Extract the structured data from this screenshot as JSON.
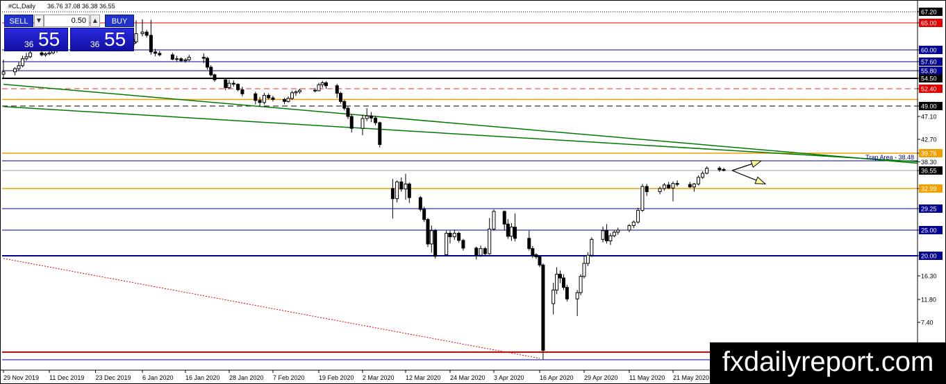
{
  "header": {
    "symbol": "#CL,Daily",
    "ohlc": "36.76 37.08 36.38 36.55"
  },
  "trade_panel": {
    "sell_label": "SELL",
    "buy_label": "BUY",
    "lot_value": "0.50",
    "sell_price_small": "36",
    "sell_price_big": "55",
    "buy_price_small": "36",
    "buy_price_big": "55"
  },
  "watermark": "fxdailyreport.com",
  "colors": {
    "red": "#e00000",
    "orange": "#f0a000",
    "navy": "#000090",
    "green": "#007a00",
    "black": "#000000",
    "gray": "#a0a0a0",
    "dashred": "#e03030",
    "hollow_up": "#ffffff",
    "panel_blue": "#2233cc",
    "tag_bg": "#000000",
    "arrow_yellow": "#ffff99"
  },
  "price_axis": [
    {
      "label": "67.20",
      "price": 67.2,
      "style": "black"
    },
    {
      "label": "65.00",
      "price": 65.0,
      "style": "red"
    },
    {
      "label": "60.00",
      "price": 60.0,
      "style": "navy"
    },
    {
      "label": "57.60",
      "price": 57.6,
      "style": "navy"
    },
    {
      "label": "55.80",
      "price": 55.8,
      "style": "navy"
    },
    {
      "label": "54.50",
      "price": 54.5,
      "style": "black"
    },
    {
      "label": "52.40",
      "price": 52.4,
      "style": "red"
    },
    {
      "label": "49.00",
      "price": 49.0,
      "style": "black"
    },
    {
      "label": "47.10",
      "price": 47.1,
      "style": "plain"
    },
    {
      "label": "42.70",
      "price": 42.7,
      "style": "plain"
    },
    {
      "label": "39.76",
      "price": 39.76,
      "style": "orange"
    },
    {
      "label": "38.30",
      "price": 38.3,
      "style": "plain"
    },
    {
      "label": "36.55",
      "price": 36.55,
      "style": "black"
    },
    {
      "label": "32.99",
      "price": 32.99,
      "style": "orange"
    },
    {
      "label": "29.25",
      "price": 29.25,
      "style": "navy"
    },
    {
      "label": "25.00",
      "price": 25.0,
      "style": "navy"
    },
    {
      "label": "20.00",
      "price": 20.0,
      "style": "navy"
    },
    {
      "label": "16.30",
      "price": 16.3,
      "style": "plain"
    },
    {
      "label": "11.80",
      "price": 11.8,
      "style": "plain"
    },
    {
      "label": "7.40",
      "price": 7.4,
      "style": "plain"
    }
  ],
  "trap_label": "Trap Area - 38.48",
  "levels": [
    {
      "price": 67.2,
      "style": "black-dotted"
    },
    {
      "price": 65.0,
      "style": "red"
    },
    {
      "price": 60.0,
      "style": "navy"
    },
    {
      "price": 57.6,
      "style": "navy"
    },
    {
      "price": 55.8,
      "style": "navy"
    },
    {
      "price": 54.5,
      "style": "black-thick"
    },
    {
      "price": 52.4,
      "style": "red-dashed"
    },
    {
      "price": 50.3,
      "style": "orange"
    },
    {
      "price": 49.0,
      "style": "black-dashed"
    },
    {
      "price": 39.76,
      "style": "orange"
    },
    {
      "price": 38.48,
      "style": "navy"
    },
    {
      "price": 36.55,
      "style": "gray"
    },
    {
      "price": 32.99,
      "style": "orange"
    },
    {
      "price": 29.25,
      "style": "navy"
    },
    {
      "price": 25.0,
      "style": "navy"
    },
    {
      "price": 20.0,
      "style": "navy-thick"
    },
    {
      "price": 0.6,
      "style": "red-thick"
    },
    {
      "price": -0.5,
      "style": "navy"
    }
  ],
  "trendlines": [
    {
      "from": {
        "day": "2019-11-29",
        "price": 53.3
      },
      "to": {
        "day": "2020-06-05",
        "price": 38.0
      }
    },
    {
      "from": {
        "day": "2019-11-29",
        "price": 48.9
      },
      "to": {
        "day": "2020-06-05",
        "price": 38.3
      }
    }
  ],
  "ma_line": {
    "from": {
      "day": "2019-11-29",
      "price": 19.5
    },
    "to": {
      "day": "2020-04-16",
      "price": -0.3
    }
  },
  "date_axis": [
    {
      "label": "29 Nov 2019",
      "day": "2019-11-29"
    },
    {
      "label": "11 Dec 2019",
      "day": "2019-12-11"
    },
    {
      "label": "23 Dec 2019",
      "day": "2019-12-23"
    },
    {
      "label": "6 Jan 2020",
      "day": "2020-01-06"
    },
    {
      "label": "16 Jan 2020",
      "day": "2020-01-16"
    },
    {
      "label": "28 Jan 2020",
      "day": "2020-01-28"
    },
    {
      "label": "7 Feb 2020",
      "day": "2020-02-07"
    },
    {
      "label": "19 Feb 2020",
      "day": "2020-02-19"
    },
    {
      "label": "2 Mar 2020",
      "day": "2020-03-02"
    },
    {
      "label": "12 Mar 2020",
      "day": "2020-03-12"
    },
    {
      "label": "24 Mar 2020",
      "day": "2020-03-24"
    },
    {
      "label": "3 Apr 2020",
      "day": "2020-04-03"
    },
    {
      "label": "16 Apr 2020",
      "day": "2020-04-16"
    },
    {
      "label": "29 Apr 2020",
      "day": "2020-04-29"
    },
    {
      "label": "11 May 2020",
      "day": "2020-05-11"
    },
    {
      "label": "21 May 2020",
      "day": "2020-05-21"
    }
  ],
  "chart_data": {
    "type": "candlestick",
    "candles": [
      {
        "day": "2019-11-29",
        "o": 55.2,
        "h": 58.0,
        "l": 54.5,
        "c": 55.6
      },
      {
        "day": "2019-12-02",
        "o": 55.6,
        "h": 56.5,
        "l": 55.0,
        "c": 56.2
      },
      {
        "day": "2019-12-03",
        "o": 56.2,
        "h": 57.5,
        "l": 55.8,
        "c": 56.8
      },
      {
        "day": "2019-12-04",
        "o": 56.8,
        "h": 58.8,
        "l": 56.5,
        "c": 58.2
      },
      {
        "day": "2019-12-05",
        "o": 58.2,
        "h": 59.4,
        "l": 57.8,
        "c": 58.6
      },
      {
        "day": "2019-12-06",
        "o": 58.6,
        "h": 60.0,
        "l": 58.3,
        "c": 59.4
      },
      {
        "day": "2019-12-09",
        "o": 59.4,
        "h": 59.7,
        "l": 58.7,
        "c": 59.0
      },
      {
        "day": "2019-12-10",
        "o": 59.0,
        "h": 59.5,
        "l": 58.6,
        "c": 59.2
      },
      {
        "day": "2019-12-11",
        "o": 59.2,
        "h": 59.8,
        "l": 58.9,
        "c": 59.4
      },
      {
        "day": "2019-12-12",
        "o": 59.4,
        "h": 60.4,
        "l": 59.1,
        "c": 59.8
      },
      {
        "day": "2019-12-13",
        "o": 59.8,
        "h": 60.3,
        "l": 59.4,
        "c": 60.0
      },
      {
        "day": "2020-01-02",
        "o": 61.2,
        "h": 62.0,
        "l": 60.8,
        "c": 61.5
      },
      {
        "day": "2020-01-03",
        "o": 61.5,
        "h": 65.5,
        "l": 61.2,
        "c": 63.0
      },
      {
        "day": "2020-01-06",
        "o": 63.0,
        "h": 65.7,
        "l": 62.5,
        "c": 63.3
      },
      {
        "day": "2020-01-07",
        "o": 63.3,
        "h": 63.7,
        "l": 62.3,
        "c": 62.7
      },
      {
        "day": "2020-01-08",
        "o": 62.7,
        "h": 65.6,
        "l": 59.0,
        "c": 59.6
      },
      {
        "day": "2020-01-09",
        "o": 59.6,
        "h": 60.2,
        "l": 58.7,
        "c": 59.3
      },
      {
        "day": "2020-01-10",
        "o": 59.3,
        "h": 59.8,
        "l": 58.7,
        "c": 59.0
      },
      {
        "day": "2020-01-13",
        "o": 59.0,
        "h": 59.4,
        "l": 57.9,
        "c": 58.1
      },
      {
        "day": "2020-01-14",
        "o": 58.1,
        "h": 58.8,
        "l": 57.6,
        "c": 58.2
      },
      {
        "day": "2020-01-15",
        "o": 58.2,
        "h": 58.5,
        "l": 57.6,
        "c": 57.8
      },
      {
        "day": "2020-01-16",
        "o": 57.8,
        "h": 58.3,
        "l": 57.4,
        "c": 58.0
      },
      {
        "day": "2020-01-17",
        "o": 58.0,
        "h": 59.0,
        "l": 57.7,
        "c": 58.5
      },
      {
        "day": "2020-01-21",
        "o": 58.5,
        "h": 59.3,
        "l": 57.3,
        "c": 58.3
      },
      {
        "day": "2020-01-22",
        "o": 58.3,
        "h": 58.6,
        "l": 56.0,
        "c": 56.5
      },
      {
        "day": "2020-01-23",
        "o": 56.5,
        "h": 56.9,
        "l": 54.8,
        "c": 55.1
      },
      {
        "day": "2020-01-24",
        "o": 55.1,
        "h": 55.3,
        "l": 53.8,
        "c": 54.2
      },
      {
        "day": "2020-01-27",
        "o": 54.2,
        "h": 54.5,
        "l": 52.1,
        "c": 52.6
      },
      {
        "day": "2020-01-28",
        "o": 52.6,
        "h": 54.2,
        "l": 52.3,
        "c": 53.5
      },
      {
        "day": "2020-01-29",
        "o": 53.5,
        "h": 54.1,
        "l": 52.8,
        "c": 53.3
      },
      {
        "day": "2020-01-30",
        "o": 53.3,
        "h": 53.5,
        "l": 51.9,
        "c": 52.2
      },
      {
        "day": "2020-01-31",
        "o": 52.2,
        "h": 52.8,
        "l": 50.9,
        "c": 51.4
      },
      {
        "day": "2020-02-03",
        "o": 51.4,
        "h": 51.8,
        "l": 49.3,
        "c": 50.1
      },
      {
        "day": "2020-02-04",
        "o": 50.1,
        "h": 50.8,
        "l": 49.0,
        "c": 49.7
      },
      {
        "day": "2020-02-05",
        "o": 49.7,
        "h": 51.6,
        "l": 49.3,
        "c": 51.1
      },
      {
        "day": "2020-02-06",
        "o": 51.1,
        "h": 51.5,
        "l": 50.3,
        "c": 50.6
      },
      {
        "day": "2020-02-07",
        "o": 50.6,
        "h": 51.0,
        "l": 49.9,
        "c": 50.3
      },
      {
        "day": "2020-02-10",
        "o": 50.3,
        "h": 50.6,
        "l": 49.4,
        "c": 49.9
      },
      {
        "day": "2020-02-11",
        "o": 49.9,
        "h": 50.9,
        "l": 49.7,
        "c": 50.5
      },
      {
        "day": "2020-02-12",
        "o": 50.5,
        "h": 52.0,
        "l": 50.2,
        "c": 51.6
      },
      {
        "day": "2020-02-13",
        "o": 51.6,
        "h": 52.1,
        "l": 51.0,
        "c": 51.8
      },
      {
        "day": "2020-02-14",
        "o": 51.8,
        "h": 52.4,
        "l": 51.4,
        "c": 52.1
      },
      {
        "day": "2020-02-18",
        "o": 52.1,
        "h": 52.5,
        "l": 51.7,
        "c": 52.0
      },
      {
        "day": "2020-02-19",
        "o": 52.0,
        "h": 53.6,
        "l": 51.9,
        "c": 53.2
      },
      {
        "day": "2020-02-20",
        "o": 53.2,
        "h": 54.0,
        "l": 52.6,
        "c": 53.6
      },
      {
        "day": "2020-02-21",
        "o": 53.6,
        "h": 53.9,
        "l": 52.4,
        "c": 53.0
      },
      {
        "day": "2020-02-24",
        "o": 53.0,
        "h": 53.4,
        "l": 50.6,
        "c": 51.5
      },
      {
        "day": "2020-02-25",
        "o": 51.5,
        "h": 51.8,
        "l": 49.5,
        "c": 49.9
      },
      {
        "day": "2020-02-26",
        "o": 49.9,
        "h": 50.2,
        "l": 48.2,
        "c": 48.6
      },
      {
        "day": "2020-02-27",
        "o": 48.6,
        "h": 48.9,
        "l": 46.6,
        "c": 47.1
      },
      {
        "day": "2020-02-28",
        "o": 47.1,
        "h": 47.5,
        "l": 44.0,
        "c": 44.8
      },
      {
        "day": "2020-03-02",
        "o": 44.8,
        "h": 47.4,
        "l": 43.5,
        "c": 46.7
      },
      {
        "day": "2020-03-03",
        "o": 46.7,
        "h": 48.6,
        "l": 46.2,
        "c": 47.2
      },
      {
        "day": "2020-03-04",
        "o": 47.2,
        "h": 47.9,
        "l": 46.0,
        "c": 46.8
      },
      {
        "day": "2020-03-05",
        "o": 46.8,
        "h": 47.2,
        "l": 45.4,
        "c": 45.9
      },
      {
        "day": "2020-03-06",
        "o": 45.9,
        "h": 46.1,
        "l": 41.0,
        "c": 41.6
      },
      {
        "day": "2020-03-09",
        "o": 33.0,
        "h": 34.9,
        "l": 27.3,
        "c": 31.1
      },
      {
        "day": "2020-03-10",
        "o": 31.1,
        "h": 34.6,
        "l": 30.4,
        "c": 34.3
      },
      {
        "day": "2020-03-11",
        "o": 34.3,
        "h": 35.2,
        "l": 32.4,
        "c": 32.9
      },
      {
        "day": "2020-03-12",
        "o": 32.9,
        "h": 35.9,
        "l": 30.9,
        "c": 33.9
      },
      {
        "day": "2020-03-13",
        "o": 33.9,
        "h": 34.2,
        "l": 30.3,
        "c": 31.3
      },
      {
        "day": "2020-03-16",
        "o": 31.3,
        "h": 31.6,
        "l": 28.7,
        "c": 29.1
      },
      {
        "day": "2020-03-17",
        "o": 29.1,
        "h": 29.6,
        "l": 26.6,
        "c": 27.1
      },
      {
        "day": "2020-03-18",
        "o": 27.1,
        "h": 27.4,
        "l": 21.7,
        "c": 22.3
      },
      {
        "day": "2020-03-19",
        "o": 22.3,
        "h": 25.9,
        "l": 20.6,
        "c": 24.9
      },
      {
        "day": "2020-03-20",
        "o": 24.9,
        "h": 25.2,
        "l": 19.5,
        "c": 19.9
      },
      {
        "day": "2020-03-23",
        "o": 20.2,
        "h": 24.9,
        "l": 20.0,
        "c": 24.4
      },
      {
        "day": "2020-03-24",
        "o": 24.4,
        "h": 24.9,
        "l": 22.4,
        "c": 23.7
      },
      {
        "day": "2020-03-25",
        "o": 23.7,
        "h": 25.1,
        "l": 23.1,
        "c": 24.4
      },
      {
        "day": "2020-03-26",
        "o": 24.4,
        "h": 24.7,
        "l": 22.6,
        "c": 23.0
      },
      {
        "day": "2020-03-27",
        "o": 23.0,
        "h": 23.3,
        "l": 21.0,
        "c": 21.5
      },
      {
        "day": "2020-03-30",
        "o": 21.5,
        "h": 21.8,
        "l": 19.3,
        "c": 20.1
      },
      {
        "day": "2020-03-31",
        "o": 20.1,
        "h": 22.0,
        "l": 19.8,
        "c": 21.4
      },
      {
        "day": "2020-04-01",
        "o": 21.4,
        "h": 21.7,
        "l": 20.0,
        "c": 20.4
      },
      {
        "day": "2020-04-02",
        "o": 20.4,
        "h": 27.4,
        "l": 20.2,
        "c": 25.2
      },
      {
        "day": "2020-04-03",
        "o": 25.2,
        "h": 29.1,
        "l": 24.9,
        "c": 28.7
      },
      {
        "day": "2020-04-06",
        "o": 28.7,
        "h": 28.9,
        "l": 25.0,
        "c": 26.2
      },
      {
        "day": "2020-04-07",
        "o": 26.2,
        "h": 27.2,
        "l": 23.3,
        "c": 23.8
      },
      {
        "day": "2020-04-08",
        "o": 23.8,
        "h": 26.4,
        "l": 22.9,
        "c": 25.6
      },
      {
        "day": "2020-04-09",
        "o": 25.6,
        "h": 28.3,
        "l": 22.8,
        "c": 23.4
      },
      {
        "day": "2020-04-13",
        "o": 23.4,
        "h": 24.9,
        "l": 21.0,
        "c": 21.4
      },
      {
        "day": "2020-04-14",
        "o": 21.4,
        "h": 21.9,
        "l": 19.6,
        "c": 20.2
      },
      {
        "day": "2020-04-15",
        "o": 20.2,
        "h": 20.5,
        "l": 19.4,
        "c": 19.8
      },
      {
        "day": "2020-04-16",
        "o": 19.8,
        "h": 20.1,
        "l": 17.9,
        "c": 18.3
      },
      {
        "day": "2020-04-17",
        "o": 18.3,
        "h": 18.6,
        "l": -0.5,
        "c": 1.0
      },
      {
        "day": "2020-04-20",
        "o": 11.0,
        "h": 15.0,
        "l": 8.9,
        "c": 13.6
      },
      {
        "day": "2020-04-21",
        "o": 13.6,
        "h": 17.9,
        "l": 12.8,
        "c": 16.6
      },
      {
        "day": "2020-04-22",
        "o": 16.6,
        "h": 17.3,
        "l": 14.9,
        "c": 15.9
      },
      {
        "day": "2020-04-23",
        "o": 15.9,
        "h": 16.6,
        "l": 13.6,
        "c": 14.1
      },
      {
        "day": "2020-04-24",
        "o": 14.1,
        "h": 14.6,
        "l": 11.4,
        "c": 11.9
      },
      {
        "day": "2020-04-27",
        "o": 11.9,
        "h": 13.6,
        "l": 8.6,
        "c": 13.1
      },
      {
        "day": "2020-04-28",
        "o": 13.1,
        "h": 16.6,
        "l": 12.6,
        "c": 16.2
      },
      {
        "day": "2020-04-29",
        "o": 16.2,
        "h": 19.9,
        "l": 15.8,
        "c": 18.6
      },
      {
        "day": "2020-04-30",
        "o": 18.6,
        "h": 20.7,
        "l": 18.1,
        "c": 20.1
      },
      {
        "day": "2020-05-01",
        "o": 20.1,
        "h": 23.6,
        "l": 19.8,
        "c": 23.2
      },
      {
        "day": "2020-05-04",
        "o": 23.2,
        "h": 25.7,
        "l": 22.6,
        "c": 24.9
      },
      {
        "day": "2020-05-05",
        "o": 24.9,
        "h": 26.2,
        "l": 22.4,
        "c": 22.9
      },
      {
        "day": "2020-05-06",
        "o": 22.9,
        "h": 24.4,
        "l": 22.1,
        "c": 23.9
      },
      {
        "day": "2020-05-07",
        "o": 23.9,
        "h": 24.9,
        "l": 23.6,
        "c": 24.6
      },
      {
        "day": "2020-05-08",
        "o": 24.6,
        "h": 25.5,
        "l": 24.1,
        "c": 25.0
      },
      {
        "day": "2020-05-11",
        "o": 25.0,
        "h": 26.2,
        "l": 24.6,
        "c": 25.9
      },
      {
        "day": "2020-05-12",
        "o": 25.9,
        "h": 26.9,
        "l": 25.4,
        "c": 26.6
      },
      {
        "day": "2020-05-13",
        "o": 26.6,
        "h": 29.4,
        "l": 26.3,
        "c": 28.9
      },
      {
        "day": "2020-05-14",
        "o": 28.9,
        "h": 33.9,
        "l": 28.6,
        "c": 33.4
      },
      {
        "day": "2020-05-15",
        "o": 33.4,
        "h": 33.9,
        "l": 31.6,
        "c": 32.4
      },
      {
        "day": "2020-05-18",
        "o": 32.4,
        "h": 33.4,
        "l": 31.9,
        "c": 33.0
      },
      {
        "day": "2020-05-19",
        "o": 33.0,
        "h": 34.1,
        "l": 32.6,
        "c": 33.7
      },
      {
        "day": "2020-05-20",
        "o": 33.7,
        "h": 34.3,
        "l": 32.9,
        "c": 33.1
      },
      {
        "day": "2020-05-21",
        "o": 33.1,
        "h": 34.4,
        "l": 30.6,
        "c": 34.0
      },
      {
        "day": "2020-05-22",
        "o": 34.0,
        "h": 34.6,
        "l": 33.4,
        "c": 33.8
      },
      {
        "day": "2020-05-25",
        "o": 33.8,
        "h": 34.3,
        "l": 33.1,
        "c": 33.3
      },
      {
        "day": "2020-05-26",
        "o": 33.3,
        "h": 34.1,
        "l": 32.4,
        "c": 33.9
      },
      {
        "day": "2020-05-27",
        "o": 33.9,
        "h": 35.6,
        "l": 33.6,
        "c": 35.2
      },
      {
        "day": "2020-05-28",
        "o": 35.2,
        "h": 36.4,
        "l": 34.9,
        "c": 36.0
      },
      {
        "day": "2020-05-29",
        "o": 36.0,
        "h": 37.4,
        "l": 35.8,
        "c": 37.0
      },
      {
        "day": "2020-06-01",
        "o": 37.0,
        "h": 37.4,
        "l": 36.3,
        "c": 36.7
      },
      {
        "day": "2020-06-02",
        "o": 36.76,
        "h": 37.08,
        "l": 36.38,
        "c": 36.55
      }
    ]
  }
}
